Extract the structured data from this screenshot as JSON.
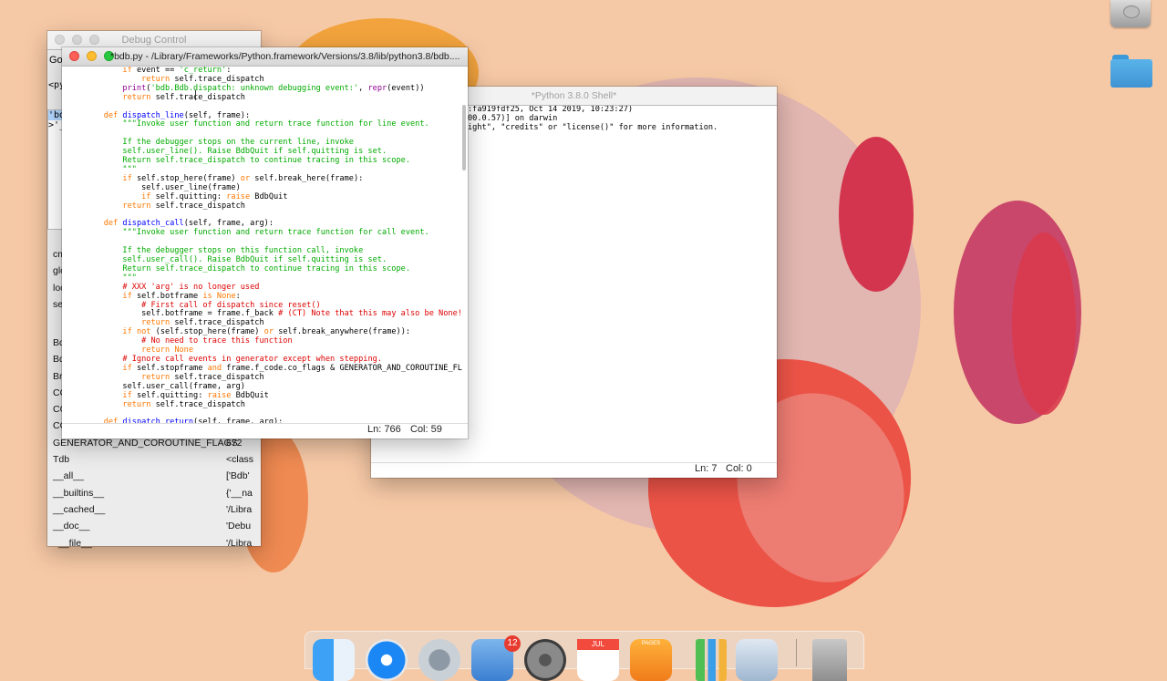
{
  "colors": {
    "accent": "#0064e1",
    "keyword": "#ff7700",
    "defname": "#0000ff",
    "string": "#00aa00",
    "comment": "#dd0000",
    "builtin": "#900090"
  },
  "desktop": {
    "icons": [
      {
        "name": "hard-drive-icon"
      },
      {
        "name": "folder-icon"
      }
    ]
  },
  "debug_control": {
    "title": "Debug Control",
    "go_label": "Go",
    "source_fragment": "<py",
    "stack_lines": [
      "'bd",
      ">'_"
    ],
    "locals_names": [
      "cm",
      "glo",
      "loc",
      "se"
    ],
    "globals": [
      {
        "name": "Bd",
        "value": ""
      },
      {
        "name": "Bd",
        "value": ""
      },
      {
        "name": "Br",
        "value": ""
      },
      {
        "name": "CO",
        "value": ""
      },
      {
        "name": "CO",
        "value": ""
      },
      {
        "name": "CO",
        "value": ""
      },
      {
        "name": "GENERATOR_AND_COROUTINE_FLAGS",
        "value": "672"
      },
      {
        "name": "Tdb",
        "value": "<class"
      },
      {
        "name": "__all__",
        "value": "['Bdb'"
      },
      {
        "name": "__builtins__",
        "value": "{'__na"
      },
      {
        "name": "__cached__",
        "value": "'/Libra"
      },
      {
        "name": "__doc__",
        "value": "'Debu"
      },
      {
        "name": "__file__",
        "value": "'/Libra"
      }
    ]
  },
  "shell": {
    "title": "*Python 3.8.0 Shell*",
    "lines": [
      ":fa919fdf25, Oct 14 2019, 10:23:27)",
      "00.0.57)] on darwin",
      "ight\", \"credits\" or \"license()\" for more information."
    ],
    "status_ln": "Ln: 7",
    "status_col": "Col: 0"
  },
  "editor": {
    "title": "*bdb.py - /Library/Frameworks/Python.framework/Versions/3.8/lib/python3.8/bdb....",
    "status_ln": "Ln: 766",
    "status_col": "Col: 59",
    "code_lines": [
      [
        [
          "        ",
          ""
        ],
        [
          "if",
          "kw"
        ],
        [
          " event == ",
          ""
        ],
        [
          "'c_return'",
          "str"
        ],
        [
          ":",
          ""
        ]
      ],
      [
        [
          "            ",
          ""
        ],
        [
          "return",
          "kw"
        ],
        [
          " self.trace_dispatch",
          ""
        ]
      ],
      [
        [
          "        ",
          ""
        ],
        [
          "print",
          "bi"
        ],
        [
          "(",
          ""
        ],
        [
          "'bdb.Bdb.dispatch: unknown debugging event:'",
          "str"
        ],
        [
          ", ",
          ""
        ],
        [
          "repr",
          "bi"
        ],
        [
          "(event))",
          ""
        ]
      ],
      [
        [
          "        ",
          ""
        ],
        [
          "return",
          "kw"
        ],
        [
          " self.trace_dispatch",
          ""
        ]
      ],
      [
        [
          "",
          ""
        ]
      ],
      [
        [
          "    ",
          ""
        ],
        [
          "def",
          "kw"
        ],
        [
          " ",
          ""
        ],
        [
          "dispatch_line",
          "def"
        ],
        [
          "(self, frame):",
          ""
        ]
      ],
      [
        [
          "        ",
          ""
        ],
        [
          "\"\"\"Invoke user function and return trace function for line event.",
          "str"
        ]
      ],
      [
        [
          "",
          ""
        ]
      ],
      [
        [
          "        If the debugger stops on the current line, invoke",
          "str"
        ]
      ],
      [
        [
          "        self.user_line(). Raise BdbQuit if self.quitting is set.",
          "str"
        ]
      ],
      [
        [
          "        Return self.trace_dispatch to continue tracing in this scope.",
          "str"
        ]
      ],
      [
        [
          "        \"\"\"",
          "str"
        ]
      ],
      [
        [
          "        ",
          ""
        ],
        [
          "if",
          "kw"
        ],
        [
          " self.stop_here(frame) ",
          ""
        ],
        [
          "or",
          "kw"
        ],
        [
          " self.break_here(frame):",
          ""
        ]
      ],
      [
        [
          "            self.user_line(frame)",
          ""
        ]
      ],
      [
        [
          "            ",
          ""
        ],
        [
          "if",
          "kw"
        ],
        [
          " self.quitting: ",
          ""
        ],
        [
          "raise",
          "kw"
        ],
        [
          " BdbQuit",
          ""
        ]
      ],
      [
        [
          "        ",
          ""
        ],
        [
          "return",
          "kw"
        ],
        [
          " self.trace_dispatch",
          ""
        ]
      ],
      [
        [
          "",
          ""
        ]
      ],
      [
        [
          "    ",
          ""
        ],
        [
          "def",
          "kw"
        ],
        [
          " ",
          ""
        ],
        [
          "dispatch_call",
          "def"
        ],
        [
          "(self, frame, arg):",
          ""
        ]
      ],
      [
        [
          "        ",
          ""
        ],
        [
          "\"\"\"Invoke user function and return trace function for call event.",
          "str"
        ]
      ],
      [
        [
          "",
          ""
        ]
      ],
      [
        [
          "        If the debugger stops on this function call, invoke",
          "str"
        ]
      ],
      [
        [
          "        self.user_call(). Raise BdbQuit if self.quitting is set.",
          "str"
        ]
      ],
      [
        [
          "        Return self.trace_dispatch to continue tracing in this scope.",
          "str"
        ]
      ],
      [
        [
          "        \"\"\"",
          "str"
        ]
      ],
      [
        [
          "        ",
          ""
        ],
        [
          "# XXX 'arg' is no longer used",
          "cmt"
        ]
      ],
      [
        [
          "        ",
          ""
        ],
        [
          "if",
          "kw"
        ],
        [
          " self.botframe ",
          ""
        ],
        [
          "is",
          "kw"
        ],
        [
          " ",
          ""
        ],
        [
          "None",
          "kw"
        ],
        [
          ":",
          ""
        ]
      ],
      [
        [
          "            ",
          ""
        ],
        [
          "# First call of dispatch since reset()",
          "cmt"
        ]
      ],
      [
        [
          "            self.botframe = frame.f_back ",
          ""
        ],
        [
          "# (CT) Note that this may also be None!",
          "cmt"
        ]
      ],
      [
        [
          "            ",
          ""
        ],
        [
          "return",
          "kw"
        ],
        [
          " self.trace_dispatch",
          ""
        ]
      ],
      [
        [
          "        ",
          ""
        ],
        [
          "if",
          "kw"
        ],
        [
          " ",
          ""
        ],
        [
          "not",
          "kw"
        ],
        [
          " (self.stop_here(frame) ",
          ""
        ],
        [
          "or",
          "kw"
        ],
        [
          " self.break_anywhere(frame)):",
          ""
        ]
      ],
      [
        [
          "            ",
          ""
        ],
        [
          "# No need to trace this function",
          "cmt"
        ]
      ],
      [
        [
          "            ",
          ""
        ],
        [
          "return",
          "kw"
        ],
        [
          " ",
          ""
        ],
        [
          "None",
          "kw"
        ]
      ],
      [
        [
          "        ",
          ""
        ],
        [
          "# Ignore call events in generator except when stepping.",
          "cmt"
        ]
      ],
      [
        [
          "        ",
          ""
        ],
        [
          "if",
          "kw"
        ],
        [
          " self.stopframe ",
          ""
        ],
        [
          "and",
          "kw"
        ],
        [
          " frame.f_code.co_flags & GENERATOR_AND_COROUTINE_FL",
          ""
        ]
      ],
      [
        [
          "            ",
          ""
        ],
        [
          "return",
          "kw"
        ],
        [
          " self.trace_dispatch",
          ""
        ]
      ],
      [
        [
          "        self.user_call(frame, arg)",
          ""
        ]
      ],
      [
        [
          "        ",
          ""
        ],
        [
          "if",
          "kw"
        ],
        [
          " self.quitting: ",
          ""
        ],
        [
          "raise",
          "kw"
        ],
        [
          " BdbQuit",
          ""
        ]
      ],
      [
        [
          "        ",
          ""
        ],
        [
          "return",
          "kw"
        ],
        [
          " self.trace_dispatch",
          ""
        ]
      ],
      [
        [
          "",
          ""
        ]
      ],
      [
        [
          "    ",
          ""
        ],
        [
          "def",
          "kw"
        ],
        [
          " ",
          ""
        ],
        [
          "dispatch_return",
          "def"
        ],
        [
          "(self, frame, arg):",
          ""
        ]
      ]
    ]
  },
  "dock": {
    "mail_badge": "12",
    "calendar_month": "JUL",
    "pages_label": "PAGES",
    "items": [
      "finder-icon",
      "safari-icon",
      "launchpad-icon",
      "mail-icon",
      "system-preferences-icon",
      "calendar-icon",
      "pages-icon",
      "numbers-icon",
      "preview-icon",
      "trash-icon"
    ]
  }
}
